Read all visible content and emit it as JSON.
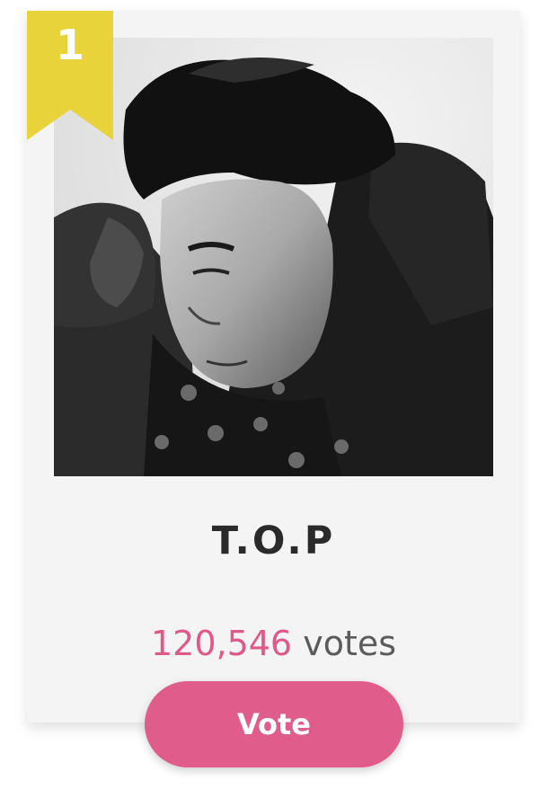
{
  "card": {
    "rank": "1",
    "name": "T.O.P",
    "votes": {
      "count": "120,546",
      "label": "votes"
    },
    "vote_button": "Vote",
    "photo": {
      "description": "profile-photo"
    }
  },
  "colors": {
    "ribbon": "#e8d43a",
    "accent": "#e05c8b",
    "vote_count": "#e0588a",
    "card_bg": "#f4f4f4",
    "name_text": "#2a2a2a",
    "label_text": "#5b5b5b"
  }
}
